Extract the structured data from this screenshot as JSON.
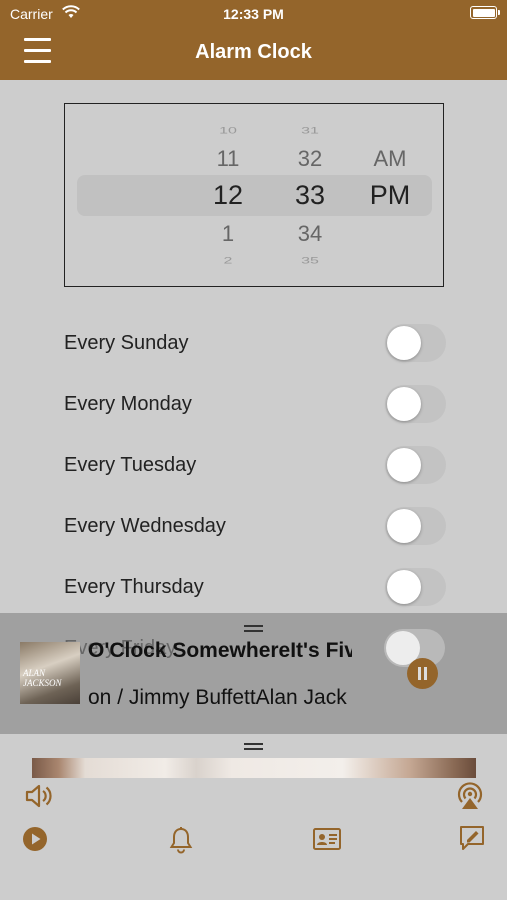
{
  "status_bar": {
    "carrier": "Carrier",
    "time": "12:33 PM"
  },
  "nav": {
    "title": "Alarm Clock"
  },
  "picker": {
    "hours": [
      "10",
      "11",
      "12",
      "1",
      "2"
    ],
    "minutes": [
      "31",
      "32",
      "33",
      "34",
      "35"
    ],
    "period": [
      "",
      "AM",
      "PM",
      "",
      ""
    ]
  },
  "days": [
    {
      "label": "Every Sunday",
      "on": false
    },
    {
      "label": "Every Monday",
      "on": false
    },
    {
      "label": "Every Tuesday",
      "on": false
    },
    {
      "label": "Every Wednesday",
      "on": false
    },
    {
      "label": "Every Thursday",
      "on": false
    },
    {
      "label": "Every Friday",
      "on": false
    }
  ],
  "player": {
    "title": "It's Five O'Clock Somewhere",
    "title_visible": "O'Clock SomewhereIt's Five",
    "artist_visible": "on / Jimmy BuffettAlan Jack",
    "album_art_text": "ALAN JACKSON"
  },
  "colors": {
    "accent": "#94652b",
    "background": "#cdcdcd"
  },
  "icons": {
    "volume": "speaker-icon",
    "airplay": "airplay-icon",
    "play": "play-circle-icon",
    "alarm": "bell-icon",
    "contact": "contact-card-icon",
    "feedback": "compose-message-icon"
  }
}
